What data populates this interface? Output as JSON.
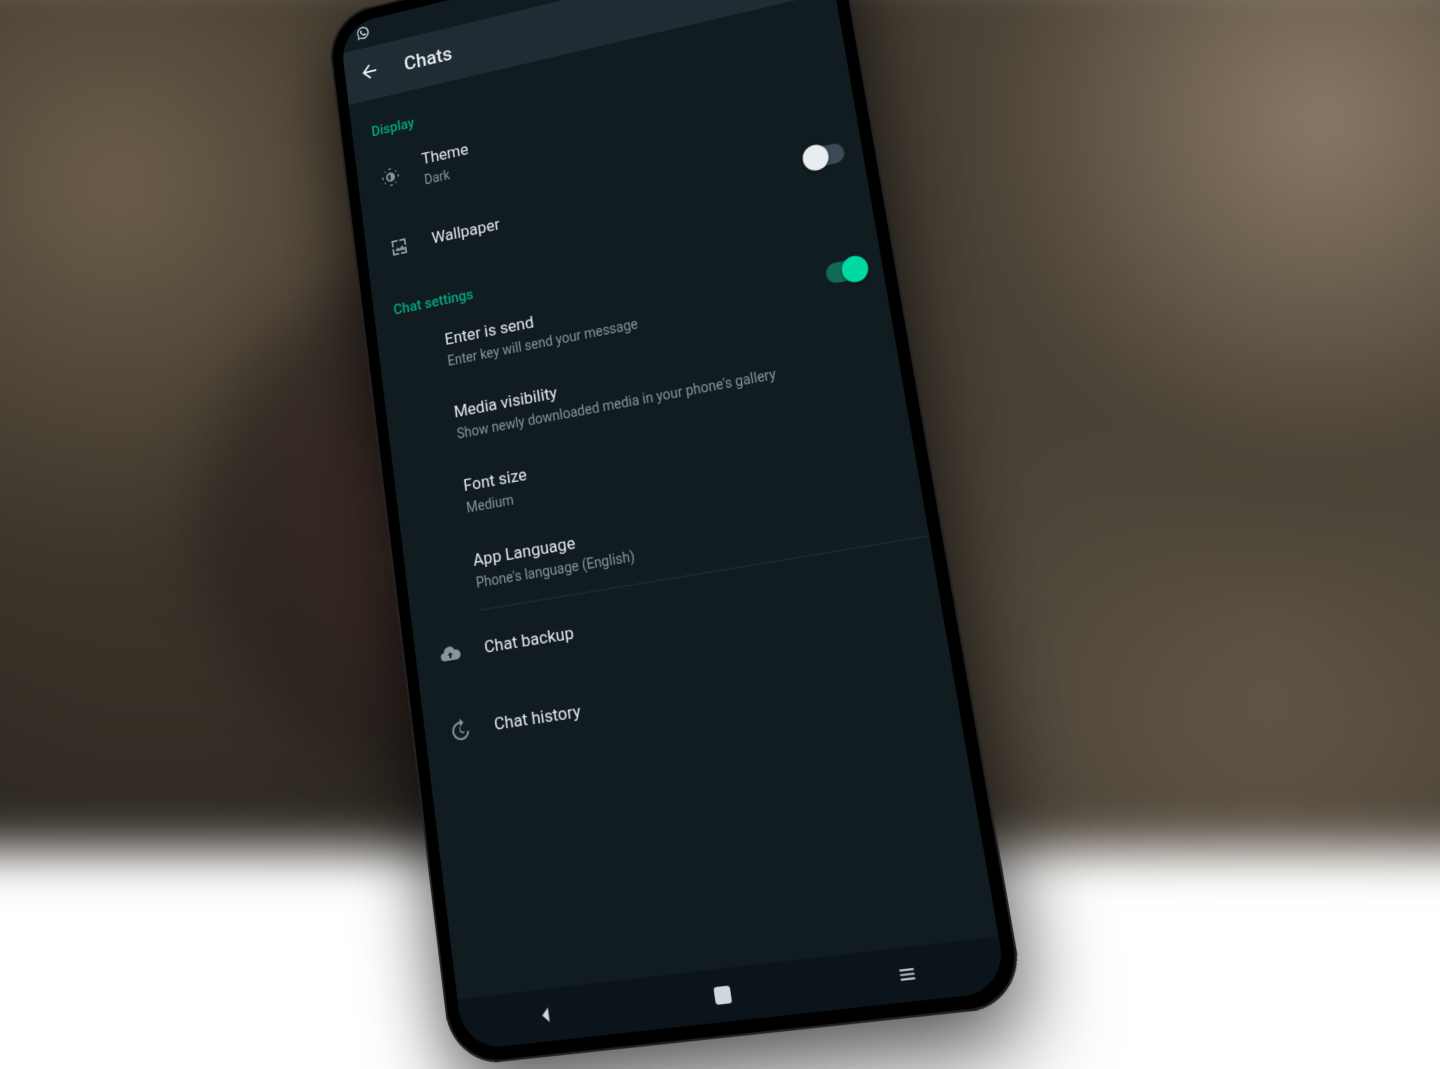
{
  "header": {
    "title": "Chats"
  },
  "sections": {
    "display": {
      "heading": "Display",
      "theme": {
        "label": "Theme",
        "value": "Dark"
      },
      "wallpaper": {
        "label": "Wallpaper"
      },
      "wallpaper_toggle": {
        "on": false
      }
    },
    "chat_settings": {
      "heading": "Chat settings",
      "enter_is_send": {
        "label": "Enter is send",
        "sub": "Enter key will send your message",
        "on": true
      },
      "media_visibility": {
        "label": "Media visibility",
        "sub": "Show newly downloaded media in your phone's gallery"
      },
      "font_size": {
        "label": "Font size",
        "value": "Medium"
      },
      "app_language": {
        "label": "App Language",
        "value": "Phone's language (English)"
      }
    },
    "other": {
      "chat_backup": {
        "label": "Chat backup"
      },
      "chat_history": {
        "label": "Chat history"
      }
    }
  },
  "colors": {
    "accent": "#00a884",
    "bg": "#111c21",
    "appbar": "#1f2c34"
  }
}
